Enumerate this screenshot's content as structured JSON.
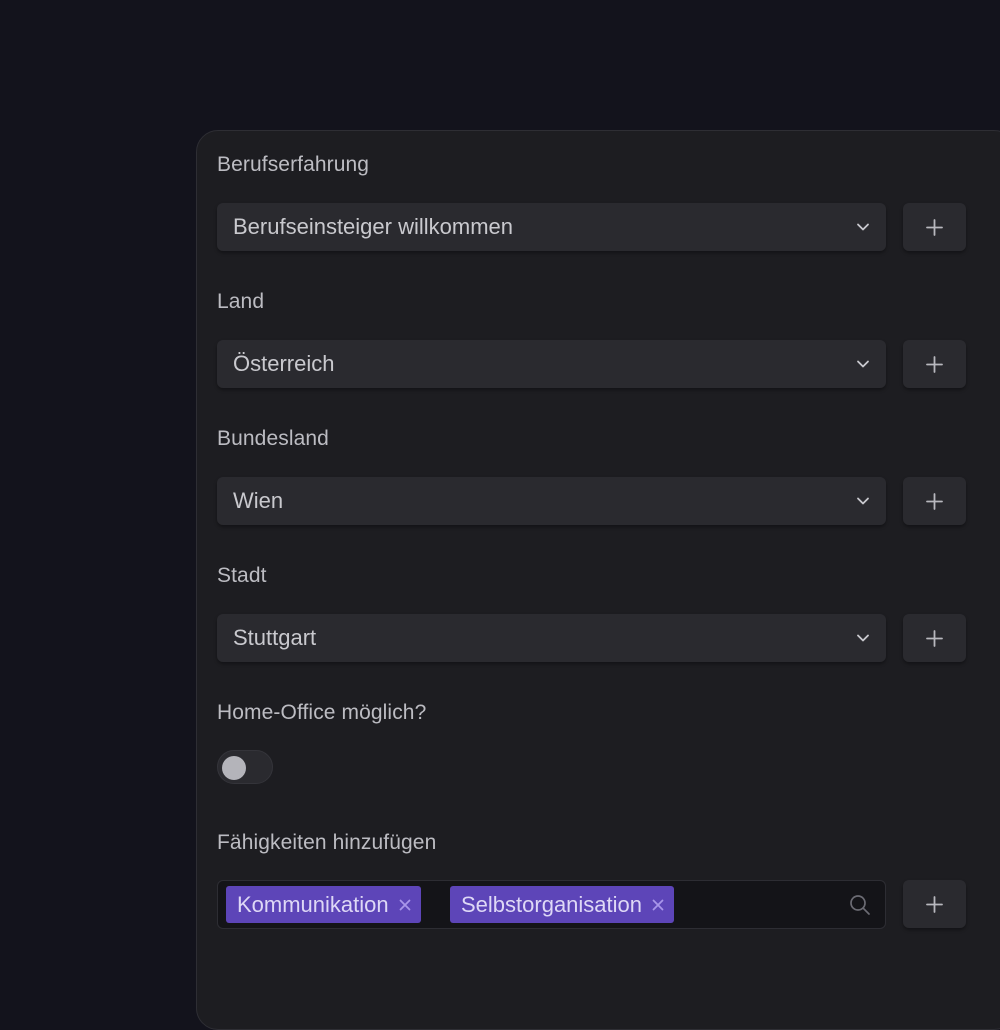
{
  "form": {
    "fields": [
      {
        "label": "Berufserfahrung",
        "value": "Berufseinsteiger willkommen"
      },
      {
        "label": "Land",
        "value": "Österreich"
      },
      {
        "label": "Bundesland",
        "value": "Wien"
      },
      {
        "label": "Stadt",
        "value": "Stuttgart"
      }
    ],
    "home_office": {
      "label": "Home-Office möglich?",
      "enabled": false
    },
    "skills": {
      "label": "Fähigkeiten hinzufügen",
      "tags": [
        "Kommunikation",
        "Selbstorganisation"
      ]
    }
  },
  "icons": {
    "dropdown": "chevron-down-icon",
    "add": "plus-icon",
    "remove_tag": "close-icon",
    "search": "search-icon"
  },
  "colors": {
    "page_background": "#13131c",
    "panel_background": "#1d1d21",
    "control_background": "#2a2a2f",
    "tag_accent": "#5d45b8"
  }
}
